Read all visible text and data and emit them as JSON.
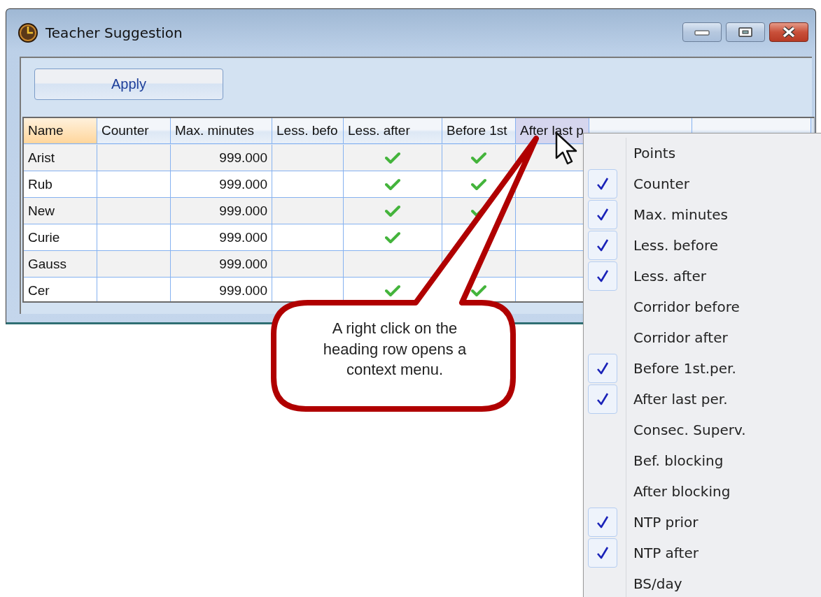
{
  "window": {
    "title": "Teacher Suggestion"
  },
  "toolbar": {
    "apply_button": "Apply"
  },
  "table": {
    "columns": [
      {
        "label": "Name",
        "sorted": true,
        "hovered": false
      },
      {
        "label": "Counter",
        "sorted": false,
        "hovered": false
      },
      {
        "label": "Max. minutes",
        "sorted": false,
        "hovered": false
      },
      {
        "label": "Less. befo",
        "sorted": false,
        "hovered": false
      },
      {
        "label": "Less. after",
        "sorted": false,
        "hovered": false
      },
      {
        "label": "Before 1st",
        "sorted": false,
        "hovered": false
      },
      {
        "label": "After last p",
        "sorted": false,
        "hovered": true
      },
      {
        "sorted": false,
        "hovered": false
      },
      {
        "sorted": false,
        "hovered": false
      }
    ],
    "rows": [
      {
        "name": "Arist",
        "max_minutes": "999.000",
        "less_after": true,
        "before_first": true
      },
      {
        "name": "Rub",
        "max_minutes": "999.000",
        "less_after": true,
        "before_first": true
      },
      {
        "name": "New",
        "max_minutes": "999.000",
        "less_after": true,
        "before_first": true
      },
      {
        "name": "Curie",
        "max_minutes": "999.000",
        "less_after": true,
        "before_first": false
      },
      {
        "name": "Gauss",
        "max_minutes": "999.000",
        "less_after": false,
        "before_first": false
      },
      {
        "name": "Cer",
        "max_minutes": "999.000",
        "less_after": true,
        "before_first": true
      }
    ]
  },
  "context_menu": {
    "items": [
      {
        "label": "Points",
        "checked": false
      },
      {
        "label": "Counter",
        "checked": true
      },
      {
        "label": "Max. minutes",
        "checked": true
      },
      {
        "label": "Less. before",
        "checked": true
      },
      {
        "label": "Less. after",
        "checked": true
      },
      {
        "label": "Corridor before",
        "checked": false
      },
      {
        "label": "Corridor after",
        "checked": false
      },
      {
        "label": "Before 1st.per.",
        "checked": true
      },
      {
        "label": "After last per.",
        "checked": true
      },
      {
        "label": "Consec. Superv.",
        "checked": false
      },
      {
        "label": "Bef. blocking",
        "checked": false
      },
      {
        "label": "After blocking",
        "checked": false
      },
      {
        "label": "NTP prior",
        "checked": true
      },
      {
        "label": "NTP after",
        "checked": true
      },
      {
        "label": "BS/day",
        "checked": false
      }
    ]
  },
  "callout": {
    "text": "A right click on the heading row opens a context menu."
  }
}
